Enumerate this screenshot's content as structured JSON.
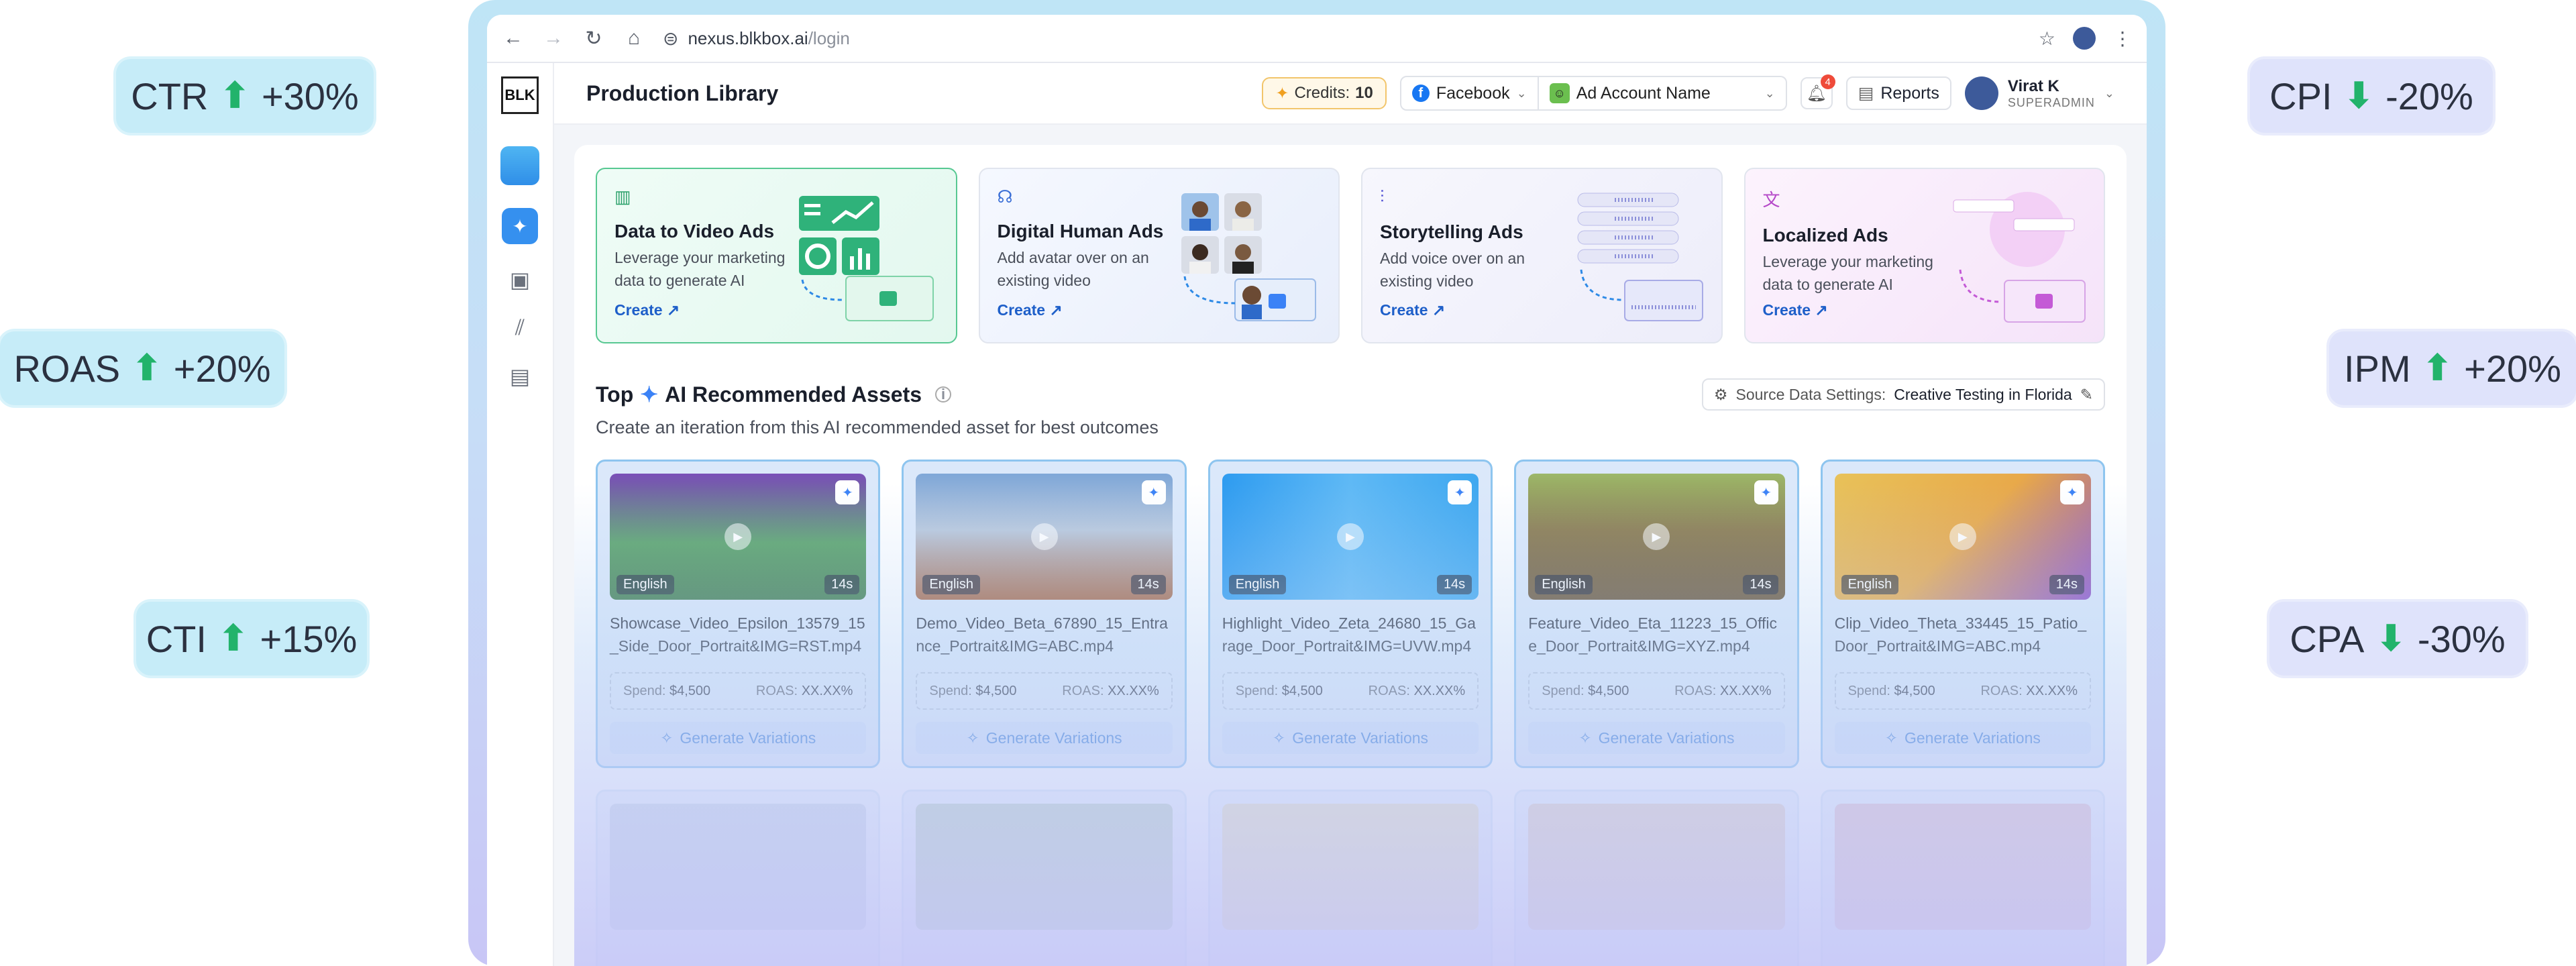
{
  "side_metrics": {
    "left": [
      {
        "label": "CTR",
        "arrow": "⬆",
        "value": "+30%"
      },
      {
        "label": "ROAS",
        "arrow": "⬆",
        "value": "+20%"
      },
      {
        "label": "CTI",
        "arrow": "⬆",
        "value": "+15%"
      }
    ],
    "right": [
      {
        "label": "CPI",
        "arrow": "⬇",
        "value": "-20%"
      },
      {
        "label": "IPM",
        "arrow": "⬆",
        "value": "+20%"
      },
      {
        "label": "CPA",
        "arrow": "⬇",
        "value": "-30%"
      }
    ]
  },
  "browser": {
    "url_host": "nexus.blkbox.ai",
    "url_path": "/login"
  },
  "sidebar": {
    "logo": "BLK"
  },
  "header": {
    "title": "Production Library",
    "credits_label": "Credits:",
    "credits_value": "10",
    "platform": "Facebook",
    "ad_account": "Ad Account Name",
    "notifications_count": "4",
    "reports_label": "Reports",
    "user_name": "Virat K",
    "user_role": "SUPERADMIN"
  },
  "cards": [
    {
      "title": "Data to Video Ads",
      "desc": "Leverage your marketing data to generate AI",
      "link": "Create ↗"
    },
    {
      "title": "Digital Human Ads",
      "desc": "Add avatar over on an existing video",
      "link": "Create ↗"
    },
    {
      "title": "Storytelling Ads",
      "desc": "Add voice over on an existing video",
      "link": "Create ↗"
    },
    {
      "title": "Localized Ads",
      "desc": "Leverage your marketing data to generate AI",
      "link": "Create ↗"
    }
  ],
  "section": {
    "title_pre": "Top",
    "title_post": "AI Recommended Assets",
    "subtitle": "Create an iteration from this AI recommended asset for best outcomes",
    "source_label": "Source Data Settings:",
    "source_value": "Creative Testing in Florida"
  },
  "assets": [
    {
      "name": "Showcase_Video_Epsilon_13579_15_Side_Door_Portrait&IMG=RST.mp4",
      "lang": "English",
      "duration": "14s",
      "spend_label": "Spend:",
      "spend": "$4,500",
      "roas_label": "ROAS:",
      "roas": "XX.XX%",
      "button": "Generate Variations",
      "color": "#5aa36a"
    },
    {
      "name": "Demo_Video_Beta_67890_15_Entrance_Portrait&IMG=ABC.mp4",
      "lang": "English",
      "duration": "14s",
      "spend_label": "Spend:",
      "spend": "$4,500",
      "roas_label": "ROAS:",
      "roas": "XX.XX%",
      "button": "Generate Variations",
      "color": "#7fa7d8"
    },
    {
      "name": "Highlight_Video_Zeta_24680_15_Garage_Door_Portrait&IMG=UVW.mp4",
      "lang": "English",
      "duration": "14s",
      "spend_label": "Spend:",
      "spend": "$4,500",
      "roas_label": "ROAS:",
      "roas": "XX.XX%",
      "button": "Generate Variations",
      "color": "#3fa8f0"
    },
    {
      "name": "Feature_Video_Eta_11223_15_Office_Door_Portrait&IMG=XYZ.mp4",
      "lang": "English",
      "duration": "14s",
      "spend_label": "Spend:",
      "spend": "$4,500",
      "roas_label": "ROAS:",
      "roas": "XX.XX%",
      "button": "Generate Variations",
      "color": "#8a7a4e"
    },
    {
      "name": "Clip_Video_Theta_33445_15_Patio_Door_Portrait&IMG=ABC.mp4",
      "lang": "English",
      "duration": "14s",
      "spend_label": "Spend:",
      "spend": "$4,500",
      "roas_label": "ROAS:",
      "roas": "XX.XX%",
      "button": "Generate Variations",
      "color": "#e8a94a"
    }
  ],
  "colors": {
    "accent": "#3590ef",
    "up": "#22b36b",
    "brand_fb": "#1877f2"
  }
}
